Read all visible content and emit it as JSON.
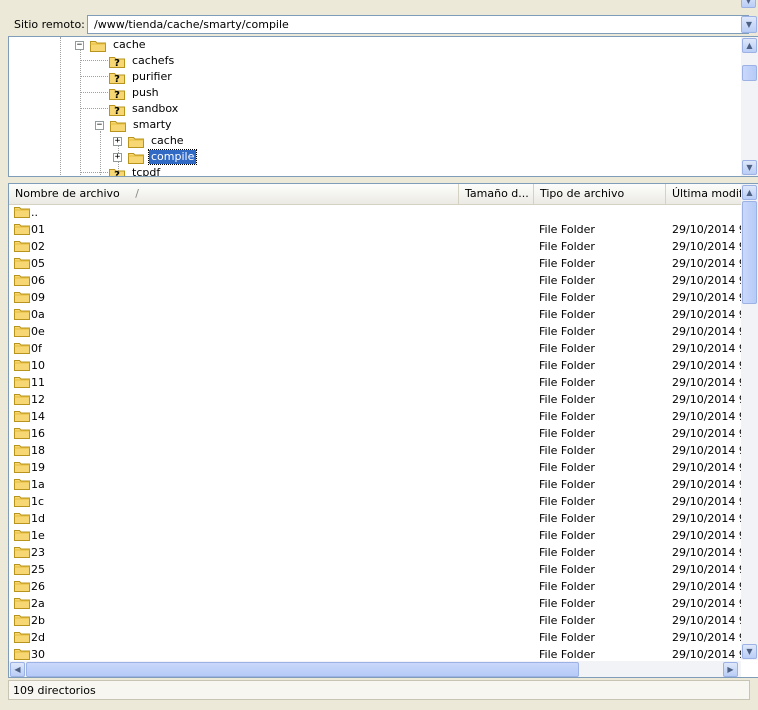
{
  "remote_site": {
    "label": "Sitio remoto:",
    "path": "/www/tienda/cache/smarty/compile"
  },
  "tree": {
    "items": [
      {
        "label": "cache",
        "kind": "folder",
        "expander": "−",
        "selected": false
      },
      {
        "label": "cachefs",
        "kind": "unknown",
        "expander": "",
        "selected": false
      },
      {
        "label": "purifier",
        "kind": "unknown",
        "expander": "",
        "selected": false
      },
      {
        "label": "push",
        "kind": "unknown",
        "expander": "",
        "selected": false
      },
      {
        "label": "sandbox",
        "kind": "unknown",
        "expander": "",
        "selected": false
      },
      {
        "label": "smarty",
        "kind": "folder",
        "expander": "−",
        "selected": false
      },
      {
        "label": "cache",
        "kind": "folder",
        "expander": "+",
        "selected": false
      },
      {
        "label": "compile",
        "kind": "folder",
        "expander": "+",
        "selected": true
      },
      {
        "label": "tcpdf",
        "kind": "unknown",
        "expander": "",
        "selected": false
      }
    ]
  },
  "file_list": {
    "columns": {
      "name": "Nombre de archivo",
      "sort_indicator": "/",
      "size": "Tamaño d...",
      "type": "Tipo de archivo",
      "modified": "Última modifica"
    },
    "parent_row": "..",
    "rows": [
      {
        "name": "01",
        "type": "File Folder",
        "modified": "29/10/2014 9:"
      },
      {
        "name": "02",
        "type": "File Folder",
        "modified": "29/10/2014 9:"
      },
      {
        "name": "05",
        "type": "File Folder",
        "modified": "29/10/2014 9:"
      },
      {
        "name": "06",
        "type": "File Folder",
        "modified": "29/10/2014 9:"
      },
      {
        "name": "09",
        "type": "File Folder",
        "modified": "29/10/2014 9:"
      },
      {
        "name": "0a",
        "type": "File Folder",
        "modified": "29/10/2014 9:"
      },
      {
        "name": "0e",
        "type": "File Folder",
        "modified": "29/10/2014 9:"
      },
      {
        "name": "0f",
        "type": "File Folder",
        "modified": "29/10/2014 9:"
      },
      {
        "name": "10",
        "type": "File Folder",
        "modified": "29/10/2014 9:"
      },
      {
        "name": "11",
        "type": "File Folder",
        "modified": "29/10/2014 9:"
      },
      {
        "name": "12",
        "type": "File Folder",
        "modified": "29/10/2014 9:"
      },
      {
        "name": "14",
        "type": "File Folder",
        "modified": "29/10/2014 9:"
      },
      {
        "name": "16",
        "type": "File Folder",
        "modified": "29/10/2014 9:"
      },
      {
        "name": "18",
        "type": "File Folder",
        "modified": "29/10/2014 9:"
      },
      {
        "name": "19",
        "type": "File Folder",
        "modified": "29/10/2014 9:"
      },
      {
        "name": "1a",
        "type": "File Folder",
        "modified": "29/10/2014 9:"
      },
      {
        "name": "1c",
        "type": "File Folder",
        "modified": "29/10/2014 9:"
      },
      {
        "name": "1d",
        "type": "File Folder",
        "modified": "29/10/2014 9:"
      },
      {
        "name": "1e",
        "type": "File Folder",
        "modified": "29/10/2014 9:"
      },
      {
        "name": "23",
        "type": "File Folder",
        "modified": "29/10/2014 9:"
      },
      {
        "name": "25",
        "type": "File Folder",
        "modified": "29/10/2014 9:"
      },
      {
        "name": "26",
        "type": "File Folder",
        "modified": "29/10/2014 9:"
      },
      {
        "name": "2a",
        "type": "File Folder",
        "modified": "29/10/2014 9:"
      },
      {
        "name": "2b",
        "type": "File Folder",
        "modified": "29/10/2014 9:"
      },
      {
        "name": "2d",
        "type": "File Folder",
        "modified": "29/10/2014 9:"
      },
      {
        "name": "30",
        "type": "File Folder",
        "modified": "29/10/2014 9:"
      }
    ]
  },
  "status": {
    "text": "109 directorios"
  },
  "icons": {
    "folder": "folder-icon",
    "unknown": "question-folder-icon",
    "scroll_up": "arrow-up-icon",
    "scroll_down": "arrow-down-icon",
    "scroll_left": "arrow-left-icon",
    "scroll_right": "arrow-right-icon",
    "dropdown": "chevron-down-icon"
  },
  "colors": {
    "selection": "#316ac5",
    "folder_fill": "#f7d774",
    "border": "#7f9db9",
    "window_bg": "#ece9d8"
  }
}
